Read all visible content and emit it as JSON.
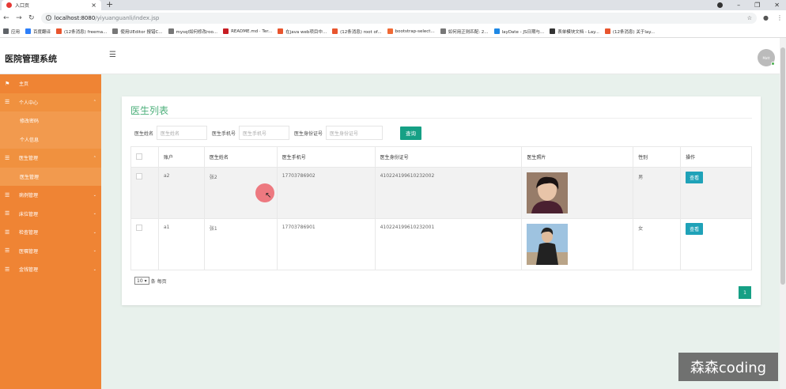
{
  "browser": {
    "tab_title": "入口页",
    "url_host": "localhost:8080",
    "url_path": "/yiyuanguanli/index.jsp",
    "bookmarks": [
      {
        "label": "应用",
        "color": "#5f6368"
      },
      {
        "label": "百度翻译",
        "color": "#2d7ff9"
      },
      {
        "label": "(12条消息) freema...",
        "color": "#e8552e"
      },
      {
        "label": "使用UEditor 报错C...",
        "color": "#777"
      },
      {
        "label": "mysql如何修改roo...",
        "color": "#777"
      },
      {
        "label": "README.md · Ter...",
        "color": "#c71d23"
      },
      {
        "label": "在java web项目中...",
        "color": "#e8552e"
      },
      {
        "label": "(12条消息) root of...",
        "color": "#e8552e"
      },
      {
        "label": "bootstrap-select...",
        "color": "#f06a35"
      },
      {
        "label": "如何用正则匹配: 2...",
        "color": "#777"
      },
      {
        "label": "layDate - JS日期与...",
        "color": "#1e88e5"
      },
      {
        "label": "表单模块文档 - Lay...",
        "color": "#333"
      },
      {
        "label": "(12条消息) 关于lay...",
        "color": "#e8552e"
      }
    ]
  },
  "app": {
    "title": "医院管理系统",
    "avatar_text": "Matt"
  },
  "sidebar": {
    "items": [
      {
        "label": "主页",
        "icon": "flag-icon",
        "expandable": false
      },
      {
        "label": "个人中心",
        "icon": "list-icon",
        "expandable": true,
        "open": true,
        "children": [
          "修改密码",
          "个人信息"
        ]
      },
      {
        "label": "医生管理",
        "icon": "list-icon",
        "expandable": true,
        "open": true,
        "children": [
          "医生管理"
        ]
      },
      {
        "label": "病例管理",
        "icon": "list-icon",
        "expandable": true
      },
      {
        "label": "床位管理",
        "icon": "list-icon",
        "expandable": true
      },
      {
        "label": "检查管理",
        "icon": "list-icon",
        "expandable": true
      },
      {
        "label": "医嘱管理",
        "icon": "list-icon",
        "expandable": true
      },
      {
        "label": "金钱管理",
        "icon": "list-icon",
        "expandable": true
      }
    ]
  },
  "page": {
    "title": "医生列表",
    "search": {
      "name_label": "医生姓名",
      "name_placeholder": "医生姓名",
      "phone_label": "医生手机号",
      "phone_placeholder": "医生手机号",
      "id_label": "医生身份证号",
      "id_placeholder": "医生身份证号",
      "button": "查询"
    },
    "table": {
      "columns": [
        "",
        "账户",
        "医生姓名",
        "医生手机号",
        "医生身份证号",
        "医生照片",
        "性别",
        "操作"
      ],
      "rows": [
        {
          "account": "a2",
          "name": "张2",
          "phone": "17703786902",
          "id_card": "410224199610232002",
          "gender": "男",
          "action": "查看",
          "photo": "dark-hair-portrait"
        },
        {
          "account": "a1",
          "name": "张1",
          "phone": "17703786901",
          "id_card": "410224199610232001",
          "gender": "女",
          "action": "查看",
          "photo": "outdoor-portrait"
        }
      ]
    },
    "pagination": {
      "page_size": "10",
      "suffix": "条 每页",
      "current": "1"
    }
  },
  "watermark": "森森coding"
}
